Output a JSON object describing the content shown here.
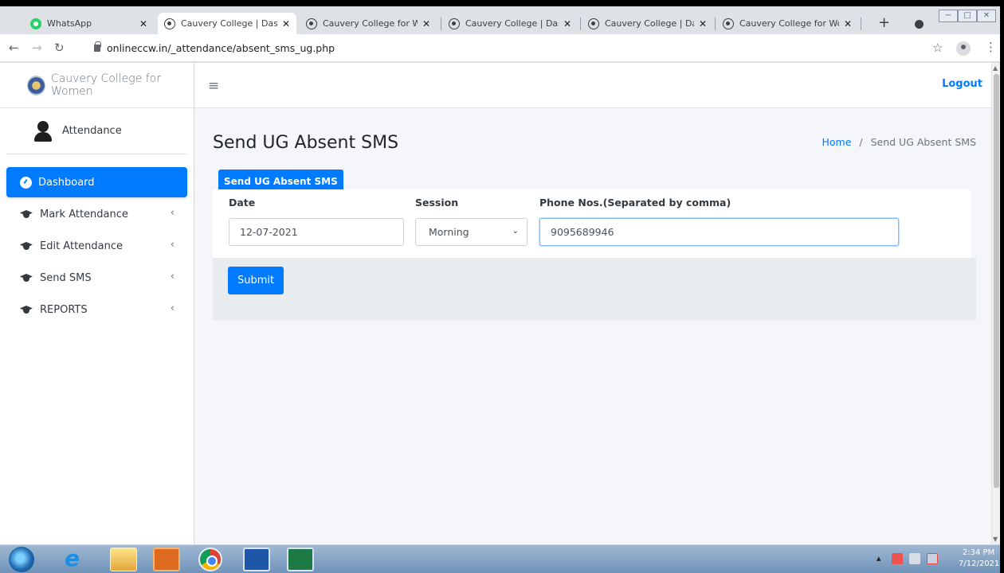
{
  "browser": {
    "tabs": [
      {
        "title": "WhatsApp",
        "close": "✕"
      },
      {
        "title": "Cauvery College | Dashb",
        "close": "✕"
      },
      {
        "title": "Cauvery College for Wo",
        "close": "✕"
      },
      {
        "title": "Cauvery College | Dashb",
        "close": "✕"
      },
      {
        "title": "Cauvery College | Dashb",
        "close": "✕"
      },
      {
        "title": "Cauvery College for Wo",
        "close": "✕"
      }
    ],
    "new_tab": "+",
    "url": "onlineccw.in/_attendance/absent_sms_ug.php"
  },
  "sidebar": {
    "brand": "Cauvery College for Women",
    "user": "Attendance",
    "items": [
      {
        "label": "Dashboard"
      },
      {
        "label": "Mark Attendance",
        "chevron": "‹"
      },
      {
        "label": "Edit Attendance",
        "chevron": "‹"
      },
      {
        "label": "Send SMS",
        "chevron": "‹"
      },
      {
        "label": "REPORTS",
        "chevron": "‹"
      }
    ]
  },
  "header": {
    "menu_icon": "≡",
    "logout": "Logout",
    "page_title": "Send UG Absent SMS",
    "breadcrumb_home": "Home",
    "breadcrumb_sep": "/",
    "breadcrumb_current": "Send UG Absent SMS"
  },
  "form": {
    "tab_label": "Send UG Absent SMS",
    "date_label": "Date",
    "date_value": "12-07-2021",
    "session_label": "Session",
    "session_value": "Morning",
    "phone_label": "Phone Nos.(Separated by comma)",
    "phone_value": "9095689946",
    "submit": "Submit"
  },
  "taskbar": {
    "time": "2:34 PM",
    "date": "7/12/2021"
  }
}
